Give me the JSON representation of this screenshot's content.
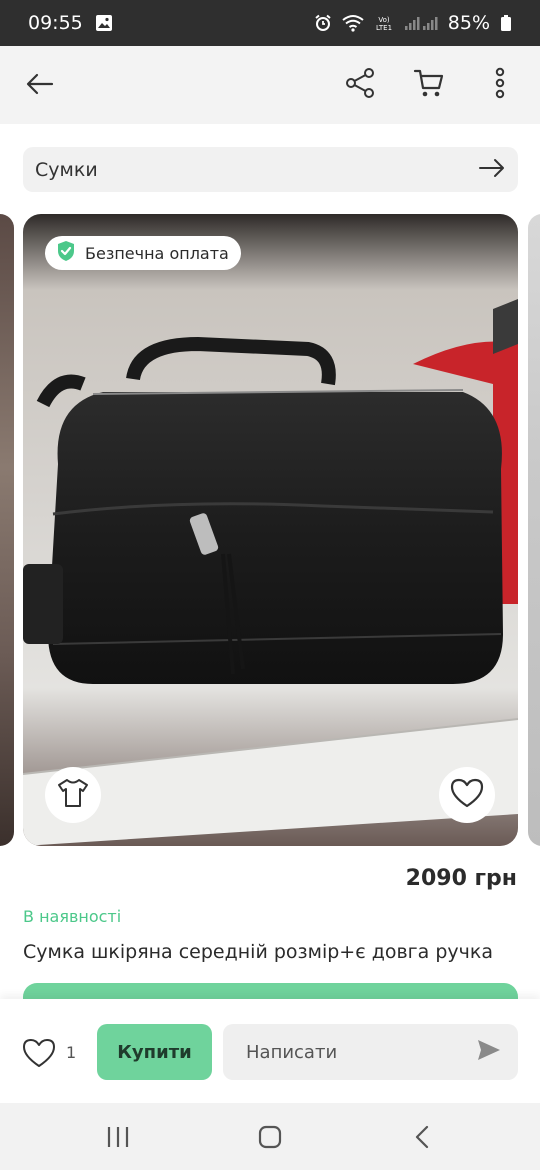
{
  "status_bar": {
    "time": "09:55",
    "battery": "85%",
    "icons": [
      "gallery-icon",
      "alarm-icon",
      "wifi-icon",
      "volte-icon",
      "signal-icon",
      "battery-icon"
    ]
  },
  "app_bar": {
    "icons": [
      "back-arrow-icon",
      "share-icon",
      "cart-icon",
      "more-vertical-icon"
    ]
  },
  "search": {
    "label": "Сумки",
    "icon": "arrow-right-icon"
  },
  "product": {
    "safe_payment_badge": "Безпечна оплата",
    "price": "2090 грн",
    "availability": "В наявності",
    "title": "Сумка шкіряна середній розмір+є довга ручка",
    "colors": {
      "accent": "#6fd39c",
      "stock_text": "#4cc88a"
    }
  },
  "actions": {
    "likes_count": "1",
    "buy_label": "Купити",
    "message_placeholder": "Написати"
  },
  "nav": {
    "icons": [
      "recent-apps-icon",
      "home-icon",
      "back-icon"
    ]
  }
}
